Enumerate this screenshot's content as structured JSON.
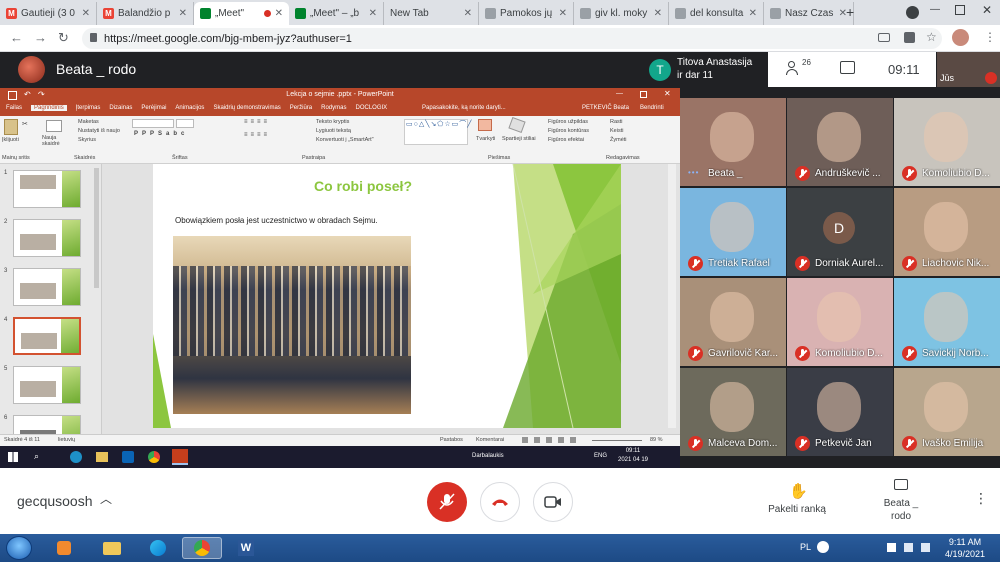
{
  "browser": {
    "tabs": [
      {
        "title": "Gautieji (3 0",
        "icon": "gmail-icon",
        "color": "#ea4335",
        "letter": "M"
      },
      {
        "title": "Balandžio p",
        "icon": "gmail-icon",
        "color": "#ea4335",
        "letter": "M"
      },
      {
        "title": "„Meet\"",
        "icon": "meet-icon",
        "color": "#00832d",
        "letter": "",
        "active": true
      },
      {
        "title": "„Meet\" – „b",
        "icon": "meet-icon",
        "color": "#00832d",
        "letter": ""
      },
      {
        "title": "New Tab",
        "icon": "",
        "color": "",
        "letter": ""
      },
      {
        "title": "Pamokos jų",
        "icon": "globe-icon",
        "color": "#9aa0a6",
        "letter": ""
      },
      {
        "title": "giv kl. moky",
        "icon": "globe-icon",
        "color": "#9aa0a6",
        "letter": ""
      },
      {
        "title": "del konsulta",
        "icon": "globe-icon",
        "color": "#9aa0a6",
        "letter": ""
      },
      {
        "title": "Nasz Czas",
        "icon": "globe-icon",
        "color": "#9aa0a6",
        "letter": ""
      }
    ],
    "url": "https://meet.google.com/bjg-mbem-jyz?authuser=1"
  },
  "meet": {
    "presenter_name": "Beata _ rodo",
    "self_name": "Titova Anastasija",
    "self_subtitle": "ir dar 11",
    "self_initial": "T",
    "participants_count": "26",
    "clock": "09:11",
    "you_label": "Jūs",
    "meeting_code": "gecqusoosh",
    "raise_hand_label": "Pakelti ranką",
    "present_label_1": "Beata _",
    "present_label_2": "rodo"
  },
  "participants": [
    {
      "name": "Beata _",
      "muted": false,
      "bg": "#9a7466"
    },
    {
      "name": "Andruškevič ...",
      "muted": true,
      "bg": "#6e5e58"
    },
    {
      "name": "Komoliubio D...",
      "muted": true,
      "bg": "#c8c4bd"
    },
    {
      "name": "Tretiak Rafael",
      "muted": true,
      "bg": "#7ab6df"
    },
    {
      "name": "Dorniak Aurel...",
      "muted": true,
      "bg": "#3c4043",
      "initial": "D"
    },
    {
      "name": "Liachovic Nik...",
      "muted": true,
      "bg": "#b89c82"
    },
    {
      "name": "Gavrilovič Kar...",
      "muted": true,
      "bg": "#a99079"
    },
    {
      "name": "Komoliubio D...",
      "muted": true,
      "bg": "#d9b2b2"
    },
    {
      "name": "Savickij Norb...",
      "muted": true,
      "bg": "#7ec3e3"
    },
    {
      "name": "Malceva Dom...",
      "muted": true,
      "bg": "#6d6a5c"
    },
    {
      "name": "Petkevič Jan",
      "muted": true,
      "bg": "#3a3d46"
    },
    {
      "name": "Ivaško Emilija",
      "muted": true,
      "bg": "#b8a68d"
    }
  ],
  "ppt": {
    "window_title": "Lekcja o sejmie .pptx - PowerPoint",
    "ribbon_tabs": [
      "Failas",
      "Pagrindinis",
      "Įterpimas",
      "Dizainas",
      "Perėjimai",
      "Animacijos",
      "Skaidrių demonstravimas",
      "Peržiūra",
      "Rodymas",
      "DOCLOGIX"
    ],
    "tell_me": "Papasakokite, ką norite daryti...",
    "user": "PETKEVIČ Beata",
    "share": "Bendrinti",
    "groups": [
      "Mainų sritis",
      "Skaidrės",
      "Šriftas",
      "Pastraipa",
      "Piešimas",
      "Redagavimas"
    ],
    "ribbon_items": {
      "paste": "Įklijuoti",
      "new_slide": "Nauja skaidrė",
      "layout": "Maketas",
      "reset": "Nustatyti iš naujo",
      "section": "Skyrius",
      "text_direction": "Teksto kryptis",
      "align_text": "Lygiuoti tekstą",
      "smartart": "Konvertuoti į „SmartArt\"",
      "arrange": "Tvarkyti",
      "quick_styles": "Spartieji stiliai",
      "fill": "Figūros užpildas",
      "outline": "Figūros kontūras",
      "effects": "Figūros efektai",
      "find": "Rasti",
      "replace": "Keisti",
      "select": "Žymėti"
    },
    "slide_numbers": [
      "1",
      "2",
      "3",
      "4",
      "5",
      "6"
    ],
    "slide": {
      "title": "Co robi poseł?",
      "body": "Obowiązkiem posła jest uczestnictwo w obradach Sejmu."
    },
    "status_left": "Skaidrė 4 iš 11",
    "status_lang": "lietuvių",
    "notes": "Pastabos",
    "comments": "Komentarai",
    "zoom": "89 %",
    "taskbar_desktop": "Darbalaukis",
    "taskbar_lang": "ENG",
    "taskbar_time": "09:11",
    "taskbar_date": "2021 04 19"
  },
  "windows": {
    "lang": "PL",
    "time": "9:11 AM",
    "date": "4/19/2021"
  },
  "colors": {
    "accent_red": "#d93025",
    "meet_bg": "#202124",
    "ppt_red": "#b7472a",
    "slide_green": "#8cc63f"
  }
}
